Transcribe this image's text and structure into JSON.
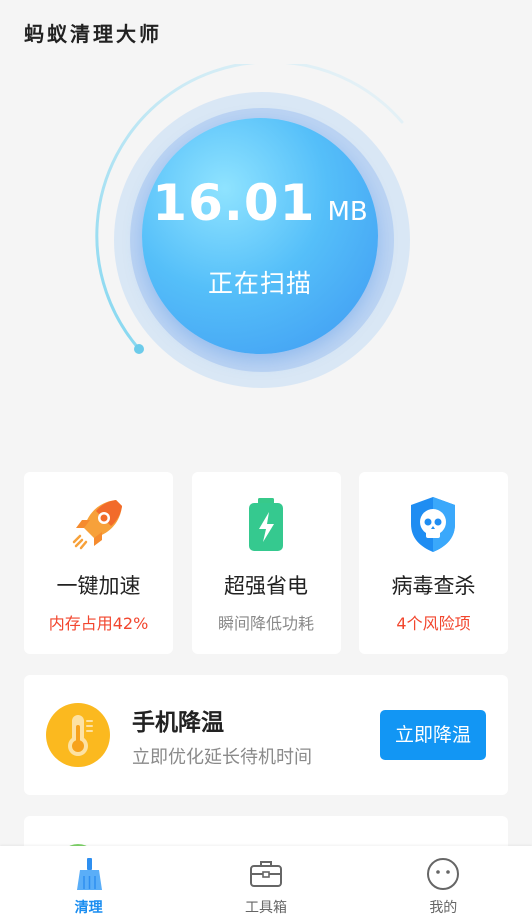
{
  "app": {
    "title": "蚂蚁清理大师"
  },
  "scan": {
    "size_value": "16.01",
    "size_unit": "MB",
    "status": "正在扫描"
  },
  "features": [
    {
      "title": "一键加速",
      "subtitle": "内存占用42%",
      "subtitle_color": "#f2462e",
      "icon": "rocket-icon"
    },
    {
      "title": "超强省电",
      "subtitle": "瞬间降低功耗",
      "subtitle_color": "#8a8a8a",
      "icon": "battery-icon"
    },
    {
      "title": "病毒查杀",
      "subtitle": "4个风险项",
      "subtitle_color": "#f2462e",
      "icon": "skull-shield-icon"
    }
  ],
  "cool": {
    "title": "手机降温",
    "subtitle": "立即优化延长待机时间",
    "button_label": "立即降温",
    "icon": "thermometer-icon"
  },
  "nav": [
    {
      "label": "清理",
      "icon": "broom-icon",
      "active": true
    },
    {
      "label": "工具箱",
      "icon": "toolbox-icon",
      "active": false
    },
    {
      "label": "我的",
      "icon": "profile-face-icon",
      "active": false
    }
  ],
  "colors": {
    "accent": "#1296f4",
    "warning": "#f2462e",
    "active_nav": "#1a8df0"
  }
}
